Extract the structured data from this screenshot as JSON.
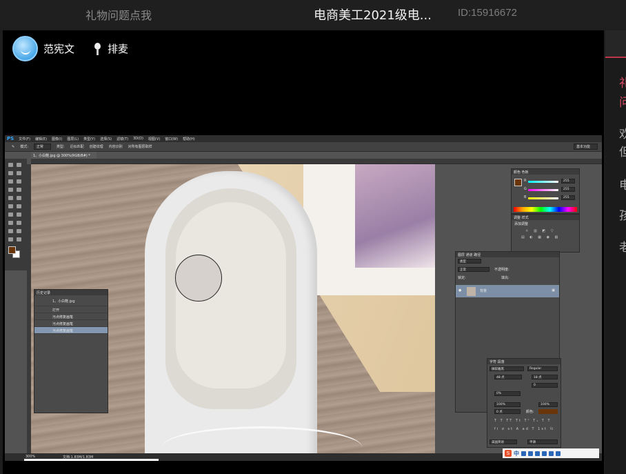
{
  "top_bar": {
    "gift_link": "礼物问题点我",
    "room_title": "电商美工2021级电...",
    "room_id": "ID:15916672"
  },
  "stream": {
    "host_name": "范宪文",
    "mic_queue_label": "排麦"
  },
  "photoshop": {
    "menu": [
      "PS",
      "文件(F)",
      "编辑(E)",
      "图像(I)",
      "图层(L)",
      "类型(Y)",
      "选择(S)",
      "滤镜(T)",
      "3D(D)",
      "视图(V)",
      "窗口(W)",
      "帮助(H)"
    ],
    "options": {
      "mode_label": "模式:",
      "mode_value": "正常",
      "type_label": "类型:",
      "type_options": [
        "近似匹配",
        "创建纹理",
        "内容识别"
      ],
      "sample_all": "对所有图层取样",
      "workspace": "基本功能"
    },
    "doc_tab": "1、小白鞋.jpg @ 300%(RGB/8#) *",
    "history_panel": {
      "title": "历史记录",
      "snapshot": "1、小白鞋.jpg",
      "steps": [
        "打开",
        "污点修复画笔",
        "污点修复画笔",
        "污点修复画笔"
      ]
    },
    "color_panel": {
      "tabs": [
        "颜色",
        "色板"
      ],
      "channels": [
        {
          "label": "R",
          "value": "255"
        },
        {
          "label": "G",
          "value": "255"
        },
        {
          "label": "B",
          "value": "255"
        }
      ]
    },
    "adjust_panel": {
      "tabs": [
        "调整",
        "样式"
      ],
      "title": "添加调整"
    },
    "layers_panel": {
      "tabs": [
        "图层",
        "通道",
        "路径"
      ],
      "kind": "类型",
      "blend": "正常",
      "opacity_label": "不透明度:",
      "lock_label": "锁定:",
      "fill_label": "填充:",
      "layer_name": "背景"
    },
    "character_panel": {
      "tabs": [
        "字符",
        "段落"
      ],
      "font_family": "微软雅黑",
      "font_style": "Regular",
      "font_size": "48 点",
      "leading": "18 点",
      "tracking": "0",
      "scale_pct": "0%",
      "vertical_scale": "100%",
      "horizontal_scale": "100%",
      "baseline": "0 点",
      "color_label": "颜色:",
      "language": "美国英语",
      "antialias": "平滑"
    },
    "status": {
      "zoom": "300%",
      "doc_size": "文档:1.83M/1.83M"
    },
    "ime": {
      "logo": "S",
      "lang": "中"
    },
    "colors": {
      "foreground": "#6a3508",
      "background": "#ffffff"
    }
  },
  "sidebar": {
    "chars": [
      "礼",
      "问",
      "欢",
      "但",
      "电",
      "孩",
      "老"
    ]
  }
}
